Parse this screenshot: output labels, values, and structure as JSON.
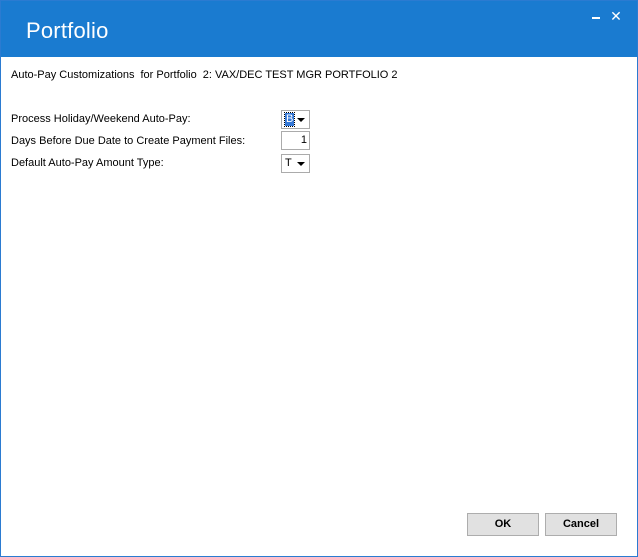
{
  "window": {
    "title": "Portfolio",
    "minimize_icon": "minimize-icon",
    "close_icon": "close-icon",
    "close_glyph": "✕"
  },
  "header": {
    "customizations_label": "Auto-Pay Customizations",
    "for_portfolio_label": "for Portfolio",
    "portfolio_name": "2: VAX/DEC TEST MGR PORTFOLIO 2"
  },
  "fields": {
    "holiday_label": "Process Holiday/Weekend Auto-Pay:",
    "holiday_value": "B",
    "days_label": "Days Before Due Date to Create Payment Files:",
    "days_value": "1",
    "amount_type_label": "Default Auto-Pay Amount Type:",
    "amount_type_value": "T"
  },
  "buttons": {
    "ok_label": "OK",
    "cancel_label": "Cancel"
  },
  "colors": {
    "titlebar": "#1a7bd0",
    "selection": "#3478d7"
  }
}
